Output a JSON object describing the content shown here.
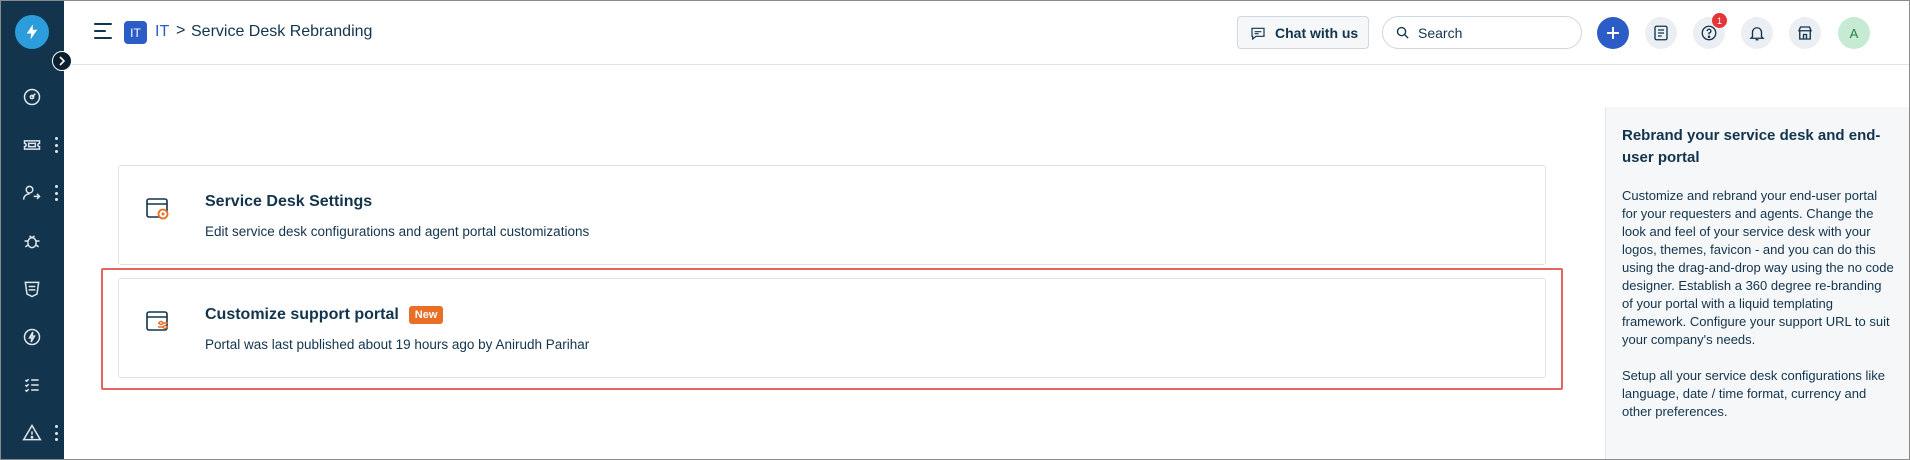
{
  "header": {
    "workspace_badge": "IT",
    "workspace_name": "IT",
    "separator": ">",
    "page_title": "Service Desk Rebranding",
    "chat_label": "Chat with us",
    "search_placeholder": "Search",
    "help_badge_count": "1",
    "avatar_initial": "A",
    "icons": [
      "menu-icon",
      "chat-icon",
      "search-icon",
      "plus-icon",
      "todo-icon",
      "help-icon",
      "bell-icon",
      "apps-icon"
    ]
  },
  "sidebar": {
    "items": [
      "dashboard-icon",
      "tickets-icon",
      "requesters-icon",
      "problems-icon",
      "changes-icon",
      "releases-icon",
      "tasks-icon",
      "alerts-icon"
    ]
  },
  "cards": [
    {
      "title": "Service Desk Settings",
      "description": "Edit service desk configurations and agent portal customizations"
    },
    {
      "title": "Customize support portal",
      "badge": "New",
      "description": "Portal was last published about 19 hours ago by Anirudh Parihar"
    }
  ],
  "side_panel": {
    "title": "Rebrand your service desk and end-user portal",
    "paragraph1": "Customize and rebrand your end-user portal for your requesters and agents. Change the look and feel of your service desk with your logos, themes, favicon - and you can do this using the drag-and-drop way using the no code designer. Establish a 360 degree re-branding of your portal with a liquid templating framework. Configure your support URL to suit your company's needs.",
    "paragraph2": "Setup all your service desk configurations like language, date / time format, currency and other preferences."
  },
  "colors": {
    "sidebar_bg": "#12344d",
    "accent": "#2c5cc5",
    "new_badge": "#e86f25",
    "highlight_border": "#e0665f",
    "card_icon_accent": "#e86f25"
  }
}
